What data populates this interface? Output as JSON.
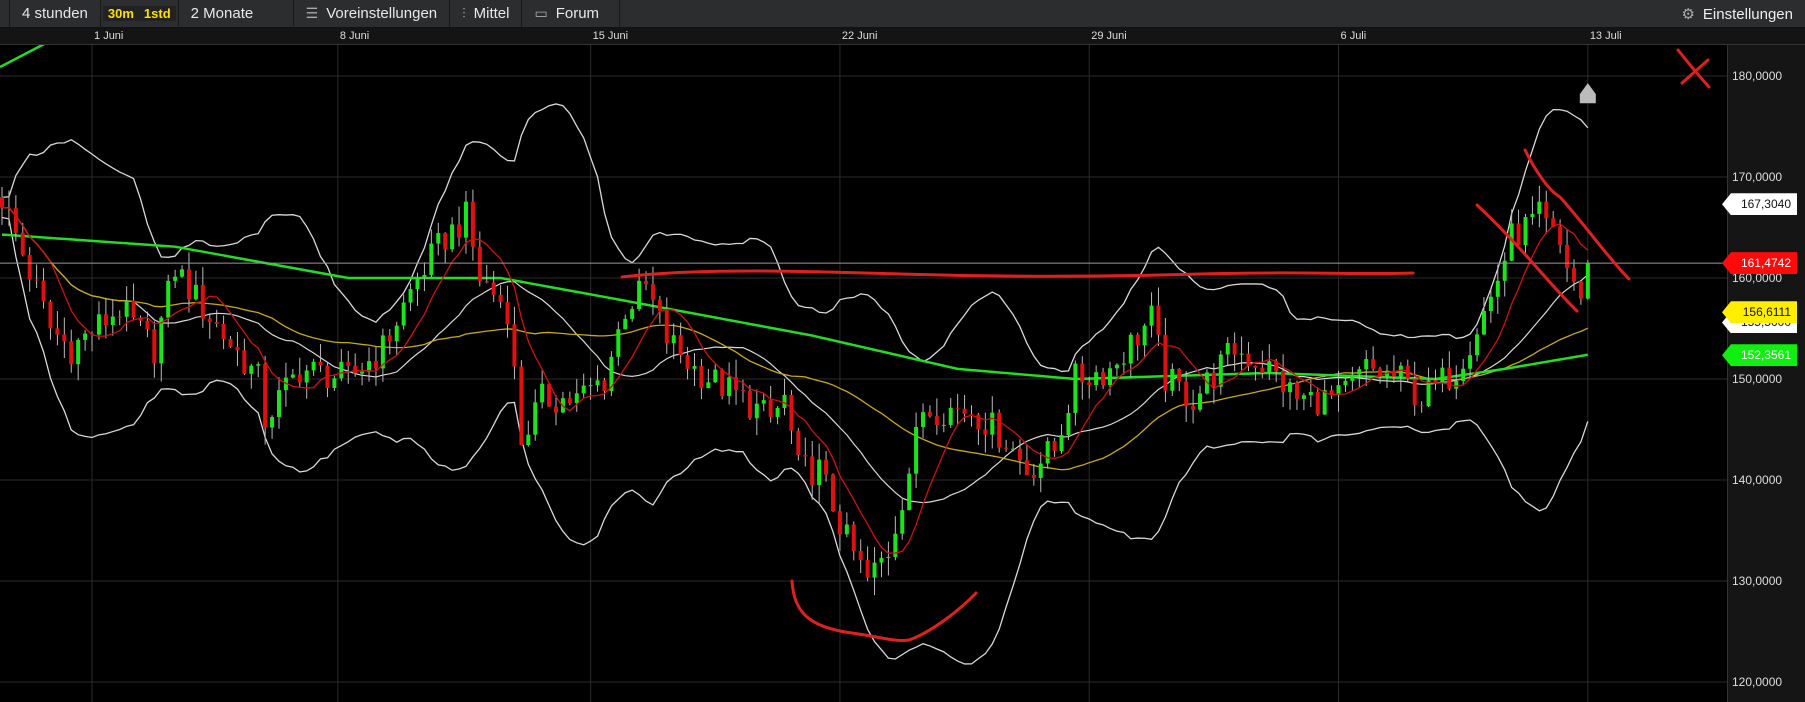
{
  "toolbar": {
    "period": "4 stunden",
    "interval_30m": "30m",
    "interval_1std": "1std",
    "range": "2 Monate",
    "presets": "Voreinstellungen",
    "chart_type": "Mittel",
    "forum": "Forum",
    "settings": "Einstellungen"
  },
  "chart_data": {
    "type": "candlestick",
    "candles": 230,
    "close_path": [
      [
        0,
        168
      ],
      [
        7,
        155
      ],
      [
        10,
        153
      ],
      [
        17,
        157
      ],
      [
        22,
        153
      ],
      [
        25,
        161
      ],
      [
        29,
        157
      ],
      [
        37,
        150
      ],
      [
        38,
        146
      ],
      [
        43,
        151
      ],
      [
        50,
        150
      ],
      [
        55,
        153
      ],
      [
        60,
        160
      ],
      [
        64,
        164
      ],
      [
        67,
        166
      ],
      [
        69,
        160
      ],
      [
        73,
        157
      ],
      [
        75,
        144
      ],
      [
        78,
        148
      ],
      [
        83,
        148
      ],
      [
        87,
        150
      ],
      [
        90,
        157
      ],
      [
        93,
        159
      ],
      [
        96,
        154
      ],
      [
        100,
        151
      ],
      [
        107,
        148
      ],
      [
        111,
        146
      ],
      [
        113,
        148
      ],
      [
        115,
        141
      ],
      [
        118,
        141
      ],
      [
        122,
        134
      ],
      [
        125,
        130
      ],
      [
        128,
        133
      ],
      [
        131,
        141
      ],
      [
        133,
        147
      ],
      [
        140,
        147
      ],
      [
        145,
        144
      ],
      [
        148,
        141
      ],
      [
        152,
        143
      ],
      [
        155,
        150
      ],
      [
        160,
        151
      ],
      [
        166,
        156
      ],
      [
        168,
        150
      ],
      [
        172,
        148
      ],
      [
        178,
        153
      ],
      [
        183,
        151
      ],
      [
        187,
        148
      ],
      [
        193,
        148
      ],
      [
        197,
        151
      ],
      [
        202,
        150
      ],
      [
        205,
        148
      ],
      [
        210,
        151
      ],
      [
        215,
        158
      ],
      [
        218,
        164
      ],
      [
        222,
        166
      ],
      [
        225,
        163
      ],
      [
        228,
        158
      ],
      [
        229,
        161.5
      ]
    ],
    "ma_long_path": [
      [
        0,
        164.3
      ],
      [
        25,
        163.1
      ],
      [
        50,
        160
      ],
      [
        72,
        160
      ],
      [
        88,
        158
      ],
      [
        117,
        154.3
      ],
      [
        138,
        151
      ],
      [
        155,
        150
      ],
      [
        183,
        150.6
      ],
      [
        207,
        150
      ],
      [
        217,
        151
      ],
      [
        229,
        152.4
      ]
    ],
    "date_ticks": [
      {
        "i": 13,
        "label": "1 Juni"
      },
      {
        "i": 48.5,
        "label": "8 Juni"
      },
      {
        "i": 85,
        "label": "15 Juni"
      },
      {
        "i": 121,
        "label": "22 Juni"
      },
      {
        "i": 157,
        "label": "29 Juni"
      },
      {
        "i": 193,
        "label": "6 Juli"
      },
      {
        "i": 229,
        "label": "13 Juli"
      }
    ],
    "y_ticks": [
      {
        "v": 180,
        "label": "180,0000"
      },
      {
        "v": 170,
        "label": "170,0000"
      },
      {
        "v": 160,
        "label": "160,0000"
      },
      {
        "v": 150,
        "label": "150,0000"
      },
      {
        "v": 140,
        "label": "140,0000"
      },
      {
        "v": 130,
        "label": "130,0000"
      },
      {
        "v": 120,
        "label": "120,0000"
      }
    ],
    "ylim": [
      117,
      183
    ],
    "last_price": 161.4742,
    "price_tags": [
      {
        "label": "167,3040",
        "v": 167.304,
        "bg": "#ffffff",
        "fg": "#111111"
      },
      {
        "label": "155,5000",
        "v": 155.6,
        "bg": "#ffffff",
        "fg": "#111111"
      },
      {
        "label": "161,4742",
        "v": 161.4742,
        "bg": "#ff0a0a",
        "fg": "#ffffff"
      },
      {
        "label": "156,6111",
        "v": 156.6111,
        "bg": "#ffee00",
        "fg": "#111111"
      },
      {
        "label": "152,3561",
        "v": 152.3561,
        "bg": "#11ee11",
        "fg": "#ffffff"
      }
    ],
    "colors": {
      "up": "#19e619",
      "down": "#e01010",
      "ma_short": "#d01010",
      "ma_mid": "#c8a818",
      "ma_long": "#22dd22",
      "bands": "#d8d8d8",
      "annotation": "#e02020"
    }
  }
}
